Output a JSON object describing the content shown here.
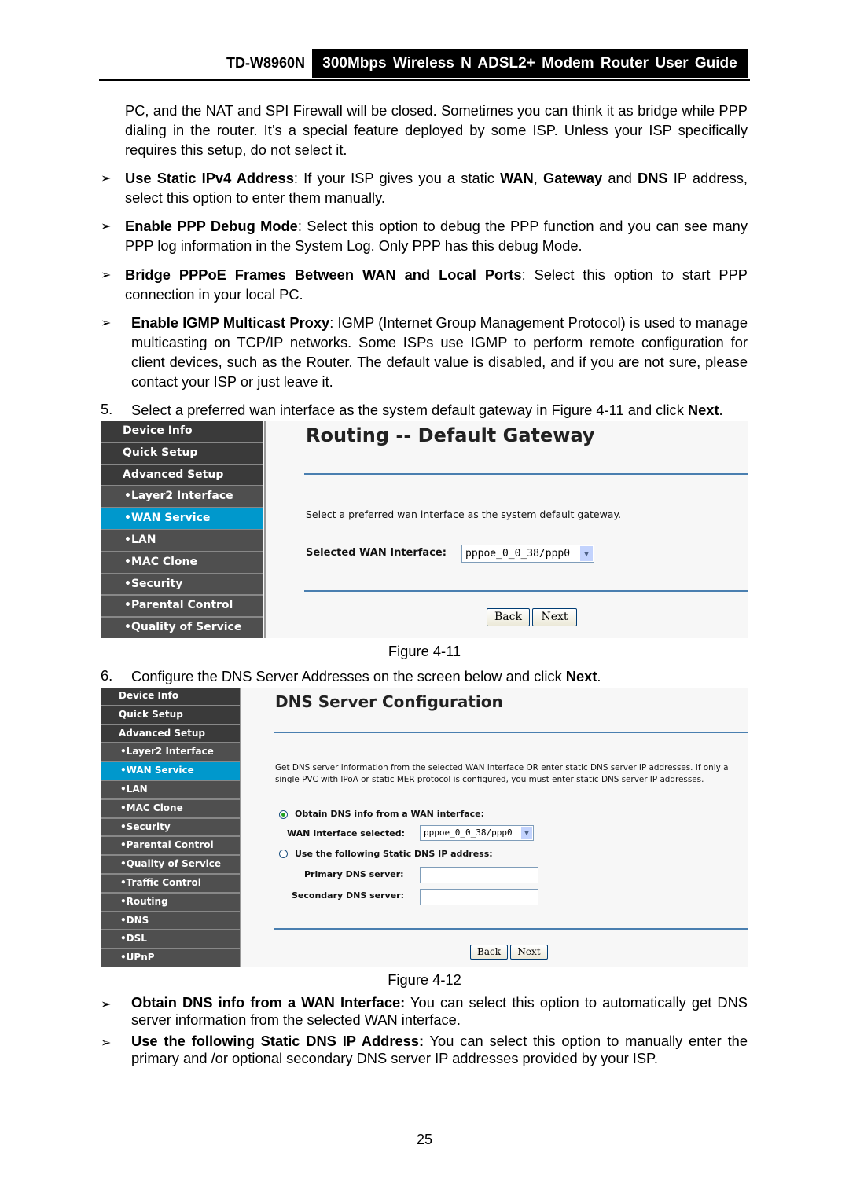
{
  "header": {
    "model": "TD-W8960N",
    "title": "300Mbps Wireless N ADSL2+ Modem Router User Guide"
  },
  "paragraphs": [
    [
      {
        "t": "PC, and the NAT and SPI Firewall will be closed. Sometimes you can think it as bridge while PPP dialing in the router. It’s a special feature deployed by some ISP. Unless your ISP specifically requires this setup, do not select it."
      }
    ],
    [
      {
        "t": "Use Static IPv4 Address",
        "b": true
      },
      {
        "t": ": If your ISP gives you a static "
      },
      {
        "t": "WAN",
        "b": true
      },
      {
        "t": ", "
      },
      {
        "t": "Gateway",
        "b": true
      },
      {
        "t": " and "
      },
      {
        "t": "DNS",
        "b": true
      },
      {
        "t": " IP address, select this option to enter them manually."
      }
    ],
    [
      {
        "t": "Enable PPP Debug Mode",
        "b": true
      },
      {
        "t": ": Select this option to debug the PPP function and you can see many PPP log information in the System Log. Only PPP has this debug Mode."
      }
    ],
    [
      {
        "t": "Bridge PPPoE Frames Between WAN and Local Ports",
        "b": true
      },
      {
        "t": ": Select this option to start PPP connection in your local PC."
      }
    ],
    [
      {
        "t": "Enable IGMP Multicast Proxy",
        "b": true
      },
      {
        "t": ": IGMP (Internet Group Management Protocol) is used to manage multicasting on TCP/IP networks. Some ISPs use IGMP to perform remote configuration for client devices, such as the Router. The default value is disabled, and if you are not sure, please contact your ISP or just leave it."
      }
    ],
    [
      {
        "t": "Select a preferred wan interface as the system default gateway in Figure 4-11 and click "
      },
      {
        "t": "Next",
        "b": true
      },
      {
        "t": "."
      }
    ],
    [
      {
        "t": "Configure the DNS Server Addresses on the screen below and click "
      },
      {
        "t": "Next",
        "b": true
      },
      {
        "t": "."
      }
    ],
    [
      {
        "t": "Obtain DNS info from a WAN Interface:",
        "b": true
      },
      {
        "t": " You can select this option to automatically get DNS server information from the selected WAN interface."
      }
    ],
    [
      {
        "t": "Use the following Static DNS IP Address:",
        "b": true
      },
      {
        "t": " You can select this option to manually enter the primary and /or optional secondary DNS server IP addresses provided by your ISP."
      }
    ]
  ],
  "steps": {
    "five": "5.",
    "six": "6."
  },
  "bullet_icon": "➢",
  "fig1": {
    "caption": "Figure 4-11",
    "menu": [
      "Device Info",
      "Quick Setup",
      "Advanced Setup",
      "•Layer2 Interface",
      "•WAN Service",
      "•LAN",
      "•MAC Clone",
      "•Security",
      "•Parental Control",
      "•Quality of Service"
    ],
    "active": "•WAN Service",
    "title": "Routing -- Default Gateway",
    "description": "Select a preferred wan interface as the system default gateway.",
    "field_label": "Selected WAN Interface:",
    "field_value": "pppoe_0_0_38/ppp0",
    "back": "Back",
    "next": "Next"
  },
  "fig2": {
    "caption": "Figure 4-12",
    "menu": [
      "Device Info",
      "Quick Setup",
      "Advanced Setup",
      "•Layer2 Interface",
      "•WAN Service",
      "•LAN",
      "•MAC Clone",
      "•Security",
      "•Parental Control",
      "•Quality of Service",
      "•Traffic Control",
      "•Routing",
      "•DNS",
      "•DSL",
      "•UPnP"
    ],
    "active": "•WAN Service",
    "title": "DNS Server Configuration",
    "description_1": "Get DNS server information from the selected WAN interface OR enter static DNS server IP addresses. If only a",
    "description_2": "single PVC with IPoA or static MER protocol is configured, you must enter static DNS server IP addresses.",
    "radio_obtain": "Obtain DNS info from a WAN interface:",
    "radio_obtain_selected": true,
    "wan_label": "WAN Interface selected:",
    "wan_value": "pppoe_0_0_38/ppp0",
    "radio_static": "Use the following Static DNS IP address:",
    "primary_label": "Primary DNS server:",
    "primary_value": "",
    "secondary_label": "Secondary DNS server:",
    "secondary_value": "",
    "back": "Back",
    "next": "Next"
  },
  "colors": {
    "active_menu": "#0098cc",
    "menu_bg": "#4f4f4f",
    "rule": "#4a7fb0"
  },
  "page_number": "25"
}
